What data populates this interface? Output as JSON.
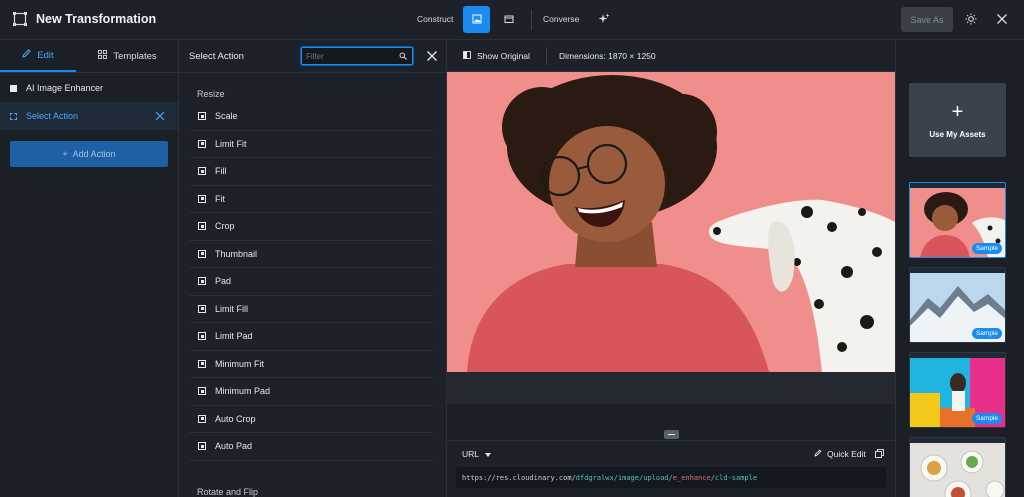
{
  "app": {
    "title": "New Transformation",
    "modes": {
      "construct": "Construct",
      "converse": "Converse"
    },
    "save_as": "Save As"
  },
  "left_panel": {
    "tabs": [
      {
        "label": "Edit"
      },
      {
        "label": "Templates"
      }
    ],
    "actions": [
      {
        "label": "AI Image Enhancer"
      },
      {
        "label": "Select Action"
      }
    ],
    "add_action": "Add Action"
  },
  "action_panel": {
    "title": "Select Action",
    "filter_placeholder": "Filter",
    "groups": [
      {
        "label": "Resize",
        "items": [
          "Scale",
          "Limit Fit",
          "Fill",
          "Fit",
          "Crop",
          "Thumbnail",
          "Pad",
          "Limit Fill",
          "Limit Pad",
          "Minimum Fit",
          "Minimum Pad",
          "Auto Crop",
          "Auto Pad"
        ]
      },
      {
        "label": "Rotate and Flip"
      }
    ]
  },
  "preview": {
    "show_original": "Show Original",
    "dimensions": "Dimensions: 1870 × 1250",
    "url_label": "URL",
    "quick_edit": "Quick Edit",
    "url": {
      "base": "https://res.cloudinary.com/",
      "cloud": "dfdgralwx",
      "path": "/image/upload/",
      "transformation": "e_enhance",
      "public_id": "/cld-sample"
    }
  },
  "assets": {
    "use_my_assets": "Use My Assets",
    "thumbnails": [
      {
        "badge": "Sample"
      },
      {
        "badge": "Sample"
      },
      {
        "badge": "Sample"
      },
      {
        "badge": ""
      }
    ]
  },
  "colors": {
    "accent": "#1a8cf0",
    "background": "#1b1f26",
    "photo_background": "#f08e8c"
  }
}
